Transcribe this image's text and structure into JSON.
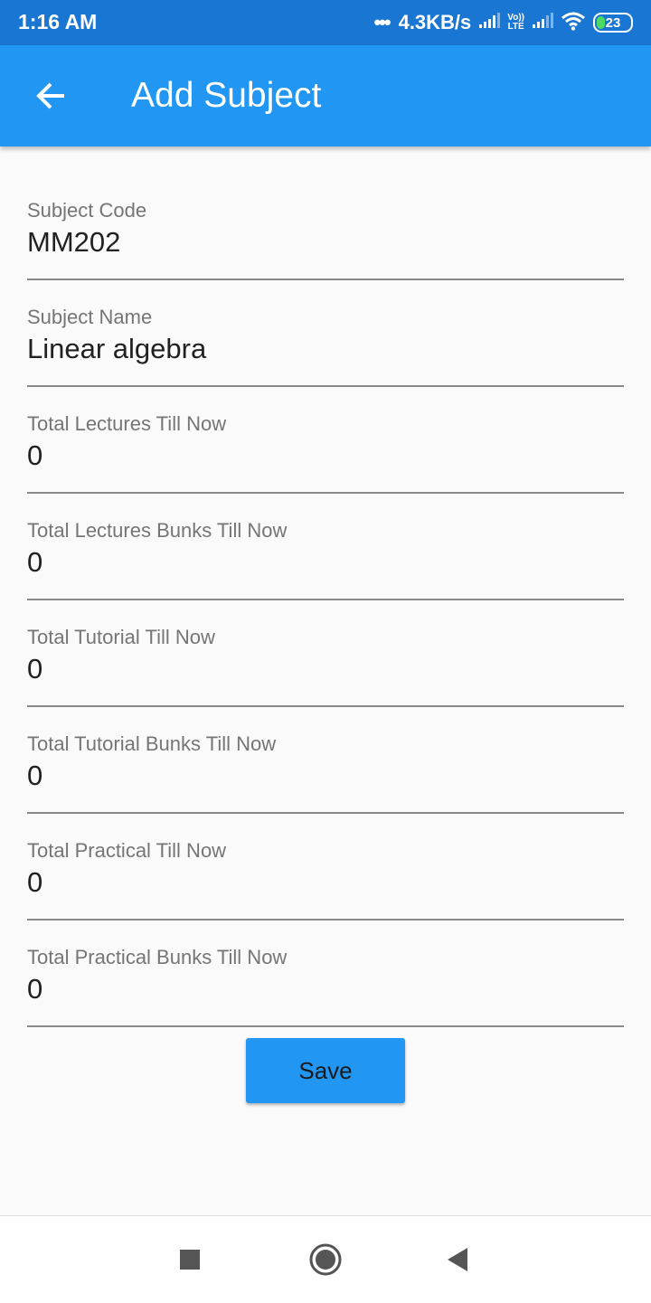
{
  "status_bar": {
    "time": "1:16 AM",
    "net_speed": "4.3KB/s",
    "lte_top": "Vo))",
    "lte_bottom": "LTE",
    "battery": "23",
    "icons": [
      "signal-icon",
      "volte-icon",
      "signal-icon",
      "wifi-icon",
      "battery-icon"
    ]
  },
  "app_bar": {
    "title": "Add Subject",
    "back_icon": "arrow-back-icon"
  },
  "form": {
    "fields": [
      {
        "label": "Subject Code",
        "value": "MM202"
      },
      {
        "label": "Subject Name",
        "value": "Linear algebra"
      },
      {
        "label": "Total Lectures Till Now",
        "value": "0"
      },
      {
        "label": "Total Lectures Bunks Till Now",
        "value": "0"
      },
      {
        "label": "Total Tutorial Till Now",
        "value": "0"
      },
      {
        "label": "Total Tutorial Bunks Till Now",
        "value": "0"
      },
      {
        "label": "Total Practical Till Now",
        "value": "0"
      },
      {
        "label": "Total Practical Bunks Till Now",
        "value": "0"
      }
    ],
    "save_label": "Save"
  },
  "nav_bar": {
    "icons": [
      "recents-square-icon",
      "home-circle-icon",
      "back-triangle-icon"
    ]
  },
  "colors": {
    "status_bar": "#1976d2",
    "app_bar": "#2196f3",
    "button": "#2196f3",
    "background": "#fafafa"
  }
}
